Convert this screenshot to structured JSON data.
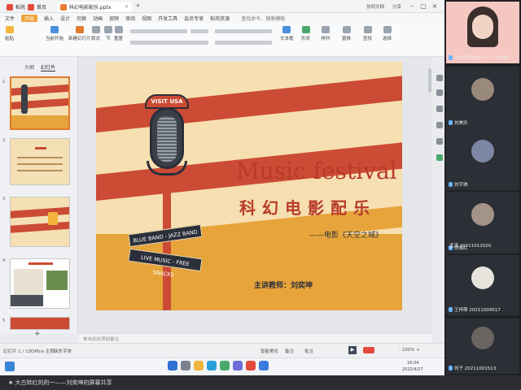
{
  "window": {
    "tabs": [
      {
        "label": "稻壳"
      },
      {
        "label": "首页"
      },
      {
        "label": "科幻电影配乐.pptx"
      }
    ],
    "new_tab": "+"
  },
  "titlebar_right": {
    "collab": "协同文档",
    "share": "分享"
  },
  "menu": [
    "文件",
    "开始",
    "插入",
    "设计",
    "切换",
    "动画",
    "放映",
    "审阅",
    "视图",
    "开发工具",
    "会员专享",
    "稻壳资源"
  ],
  "menu_right": {
    "search": "查找命令、搜索模板"
  },
  "toolbar": {
    "buttons": [
      {
        "label": "粘贴"
      },
      {
        "label": "当前开始"
      },
      {
        "label": "新建幻灯片"
      },
      {
        "label": "版式"
      },
      {
        "label": "节"
      },
      {
        "label": "重置"
      }
    ],
    "right_buttons": [
      {
        "label": "文本框"
      },
      {
        "label": "形状"
      },
      {
        "label": "排列"
      },
      {
        "label": "替换"
      },
      {
        "label": "查找"
      },
      {
        "label": "选择"
      }
    ]
  },
  "leftpanel": {
    "tabs": [
      {
        "label": "大纲"
      },
      {
        "label": "幻灯片"
      }
    ],
    "slide_numbers": [
      "1",
      "2",
      "3",
      "4",
      "5"
    ],
    "add": "+"
  },
  "slide": {
    "sign": "VISIT USA",
    "title": "Music festival",
    "subtitle_cn": "科幻电影配乐",
    "movie": "——电影《天空之城》",
    "band1": "BLUE BAND - JAZZ BAND",
    "band2": "LIVE MUSIC - FREE SNACKS",
    "teacher": "主讲教师：刘奕坤"
  },
  "notes": {
    "placeholder": "单击此处添加备注"
  },
  "statusbar": {
    "slide_pos": "幻灯片 1 / 13",
    "theme": "Office 主题",
    "font_missing": "缺失字体",
    "smart": "智能美化",
    "notes_btn": "备注",
    "comment": "批注",
    "zoom": "- 100% +"
  },
  "taskbar_time": {
    "time": "16:04",
    "date": "2022/4/27"
  },
  "banner": "★ 大古转红的的一——刘奕坤的屏幕共享",
  "participants": [
    {
      "name": "大古转红的的一——刘奕坤",
      "avatar_color": "#f4c7c0"
    },
    {
      "name": "刘美玲",
      "avatar_color": "#9a8a7c"
    },
    {
      "name": "刘宇琪",
      "avatar_color": "#7d86a2"
    },
    {
      "name": "刘晓红",
      "avatar_color": "#a39388"
    },
    {
      "name": "孟涛 20211012020",
      "avatar_color": "#c9c7d6"
    },
    {
      "name": "王梓萌 20211009517",
      "avatar_color": "#e7e4de"
    },
    {
      "name": "刘子 20211001513",
      "avatar_color": "#6a6560"
    }
  ],
  "colors": {
    "accent": "#f0a238",
    "slide_red": "#cc4b34",
    "slide_bg": "#f6dfb0",
    "title_red": "#b73a2a",
    "dark": "#2a2f3a"
  }
}
